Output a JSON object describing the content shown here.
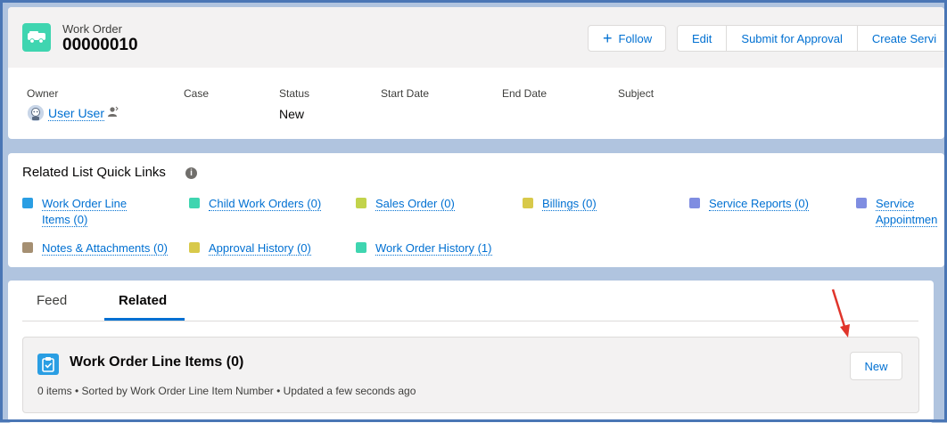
{
  "record": {
    "type_label": "Work Order",
    "name": "00000010",
    "icon": "truck-icon",
    "accent_color": "#3fd5b0"
  },
  "actions": {
    "follow": "Follow",
    "edit": "Edit",
    "submit": "Submit for Approval",
    "create": "Create Servi"
  },
  "fields": {
    "owner_label": "Owner",
    "owner_value": "User User",
    "case_label": "Case",
    "status_label": "Status",
    "status_value": "New",
    "start_label": "Start Date",
    "end_label": "End Date",
    "subject_label": "Subject"
  },
  "quick_links": {
    "title": "Related List Quick Links",
    "items": [
      {
        "line1": "Work Order Line",
        "line2": "Items (0)",
        "color": "#2a9ee3"
      },
      {
        "line1": "Child Work Orders (0)",
        "color": "#3fd5b0"
      },
      {
        "line1": "Sales Order (0)",
        "color": "#c2d34b"
      },
      {
        "line1": "Billings (0)",
        "color": "#d8c94a"
      },
      {
        "line1": "Service Reports (0)",
        "color": "#7f8de1"
      },
      {
        "line1": "Service",
        "line2": "Appointmen",
        "color": "#7f8de1"
      },
      {
        "line1": "Notes & Attachments (0)",
        "color": "#a58f72"
      },
      {
        "line1": "Approval History (0)",
        "color": "#d8c94a"
      },
      {
        "line1": "Work Order History (1)",
        "color": "#3fd5b0"
      }
    ]
  },
  "tabs": {
    "feed": "Feed",
    "related": "Related"
  },
  "related_list": {
    "title": "Work Order Line Items (0)",
    "meta": "0 items • Sorted by Work Order Line Item Number • Updated a few seconds ago",
    "new_button": "New",
    "icon": "clipboard-icon",
    "icon_color": "#2a9ee3"
  }
}
